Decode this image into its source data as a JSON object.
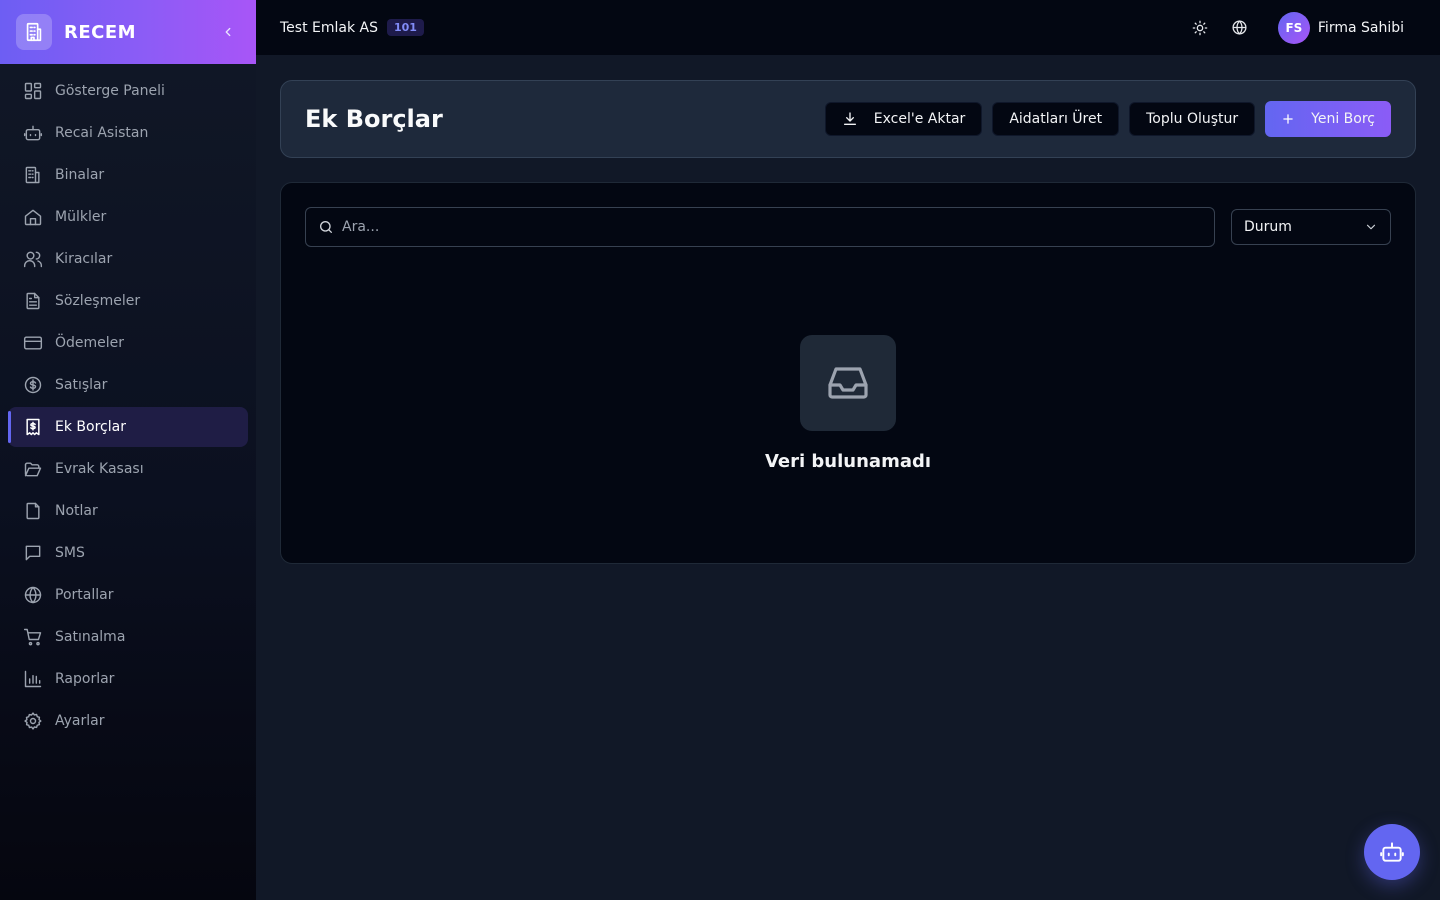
{
  "brand": {
    "name": "RECEM"
  },
  "sidebar": {
    "items": [
      {
        "label": "Gösterge Paneli",
        "icon": "dashboard-icon"
      },
      {
        "label": "Recai Asistan",
        "icon": "bot-icon"
      },
      {
        "label": "Binalar",
        "icon": "building-icon"
      },
      {
        "label": "Mülkler",
        "icon": "home-icon"
      },
      {
        "label": "Kiracılar",
        "icon": "users-icon"
      },
      {
        "label": "Sözleşmeler",
        "icon": "file-text-icon"
      },
      {
        "label": "Ödemeler",
        "icon": "credit-card-icon"
      },
      {
        "label": "Satışlar",
        "icon": "dollar-circle-icon"
      },
      {
        "label": "Ek Borçlar",
        "icon": "receipt-dollar-icon",
        "active": true
      },
      {
        "label": "Evrak Kasası",
        "icon": "folder-open-icon"
      },
      {
        "label": "Notlar",
        "icon": "sticky-note-icon"
      },
      {
        "label": "SMS",
        "icon": "message-square-icon"
      },
      {
        "label": "Portallar",
        "icon": "globe-icon"
      },
      {
        "label": "Satınalma",
        "icon": "shopping-cart-icon"
      },
      {
        "label": "Raporlar",
        "icon": "bar-chart-icon"
      },
      {
        "label": "Ayarlar",
        "icon": "settings-icon"
      }
    ]
  },
  "topbar": {
    "company": "Test Emlak AS",
    "company_badge": "101",
    "user_initials": "FS",
    "user_name": "Firma Sahibi"
  },
  "header": {
    "title": "Ek Borçlar",
    "export_label": "Excel'e Aktar",
    "generate_label": "Aidatları Üret",
    "bulk_label": "Toplu Oluştur",
    "new_label": "Yeni Borç"
  },
  "filters": {
    "search_placeholder": "Ara...",
    "status_label": "Durum"
  },
  "empty_state": {
    "message": "Veri bulunamadı"
  },
  "colors": {
    "accent": "#6366f1",
    "accent_secondary": "#8b5cf6",
    "background": "#111827",
    "card": "#1e293b"
  }
}
